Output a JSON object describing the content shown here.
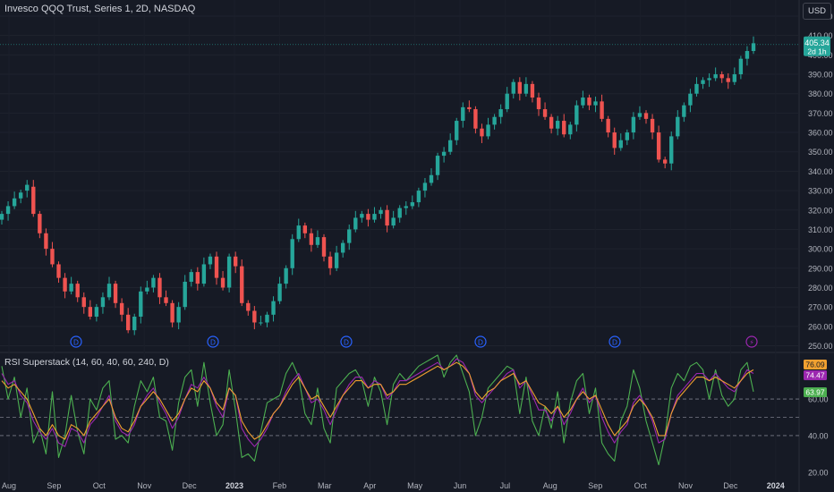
{
  "header": {
    "title": "Invesco QQQ Trust, Series 1, 2D, NASDAQ",
    "currency": "USD"
  },
  "price_badge": {
    "value": "405.34",
    "countdown": "2d 1h"
  },
  "rsi_panel": {
    "title": "RSI Superstack (14, 60, 40, 60, 240, D)",
    "badges": [
      "76.09",
      "74.47",
      "63.97"
    ]
  },
  "colors": {
    "background": "#161a25",
    "up": "#26a69a",
    "down": "#ef5350",
    "rsi_orange": "#f0a030",
    "rsi_purple": "#9c27b0",
    "rsi_green": "#4caf50",
    "dividend_marker": "#2962ff",
    "split_marker": "#9c27b0"
  },
  "event_markers": [
    {
      "label": "D",
      "type": "dividend"
    },
    {
      "label": "D",
      "type": "dividend"
    },
    {
      "label": "D",
      "type": "dividend"
    },
    {
      "label": "D",
      "type": "dividend"
    },
    {
      "label": "D",
      "type": "dividend"
    },
    {
      "label": "⚡",
      "type": "split"
    }
  ],
  "chart_data": [
    {
      "type": "candlestick",
      "title": "Invesco QQQ Trust, Series 1, 2D, NASDAQ",
      "ylim": [
        247,
        420
      ],
      "yticks": [
        250,
        260,
        270,
        280,
        290,
        300,
        310,
        320,
        330,
        340,
        350,
        360,
        370,
        380,
        390,
        400,
        410,
        420
      ],
      "ytick_labels": [
        "250.00",
        "260.00",
        "270.00",
        "280.00",
        "290.00",
        "300.00",
        "310.00",
        "320.00",
        "330.00",
        "340.00",
        "350.00",
        "360.00",
        "370.00",
        "380.00",
        "390.00",
        "400.00",
        "410.00",
        "420.00"
      ],
      "last_price": 405.34,
      "xlabels": [
        "Aug",
        "Sep",
        "Oct",
        "Nov",
        "Dec",
        "2023",
        "Feb",
        "Mar",
        "Apr",
        "May",
        "Jun",
        "Jul",
        "Aug",
        "Sep",
        "Oct",
        "Nov",
        "Dec",
        "2024"
      ],
      "close": [
        318,
        322,
        326,
        329,
        333,
        318,
        308,
        300,
        292,
        285,
        278,
        282,
        275,
        270,
        265,
        270,
        275,
        282,
        272,
        266,
        258,
        265,
        278,
        280,
        285,
        275,
        272,
        262,
        270,
        283,
        288,
        282,
        292,
        296,
        285,
        280,
        296,
        291,
        272,
        268,
        262,
        262,
        266,
        273,
        282,
        290,
        305,
        312,
        308,
        302,
        306,
        296,
        290,
        298,
        303,
        310,
        316,
        318,
        315,
        318,
        320,
        312,
        316,
        321,
        322,
        324,
        330,
        334,
        338,
        348,
        350,
        356,
        366,
        373,
        372,
        362,
        358,
        364,
        368,
        372,
        380,
        386,
        380,
        385,
        378,
        372,
        368,
        362,
        366,
        359,
        364,
        374,
        378,
        374,
        376,
        367,
        360,
        352,
        356,
        360,
        368,
        370,
        367,
        360,
        346,
        344,
        358,
        368,
        374,
        380,
        385,
        387,
        388,
        390,
        388,
        386,
        390,
        398,
        402,
        406
      ],
      "open": [
        315,
        318,
        322,
        326,
        330,
        332,
        318,
        308,
        300,
        292,
        285,
        278,
        282,
        275,
        270,
        265,
        270,
        275,
        282,
        272,
        266,
        258,
        265,
        278,
        280,
        285,
        275,
        272,
        262,
        270,
        283,
        288,
        282,
        292,
        296,
        285,
        280,
        296,
        291,
        272,
        268,
        262,
        262,
        266,
        273,
        282,
        290,
        305,
        312,
        308,
        302,
        306,
        296,
        290,
        298,
        303,
        310,
        316,
        318,
        315,
        318,
        320,
        312,
        316,
        321,
        322,
        324,
        330,
        334,
        338,
        348,
        350,
        356,
        366,
        373,
        372,
        362,
        358,
        364,
        368,
        372,
        380,
        386,
        380,
        385,
        378,
        372,
        368,
        362,
        366,
        359,
        364,
        374,
        378,
        374,
        376,
        367,
        360,
        352,
        356,
        360,
        368,
        370,
        367,
        360,
        346,
        344,
        358,
        368,
        374,
        380,
        385,
        387,
        388,
        390,
        388,
        386,
        390,
        398,
        402
      ]
    },
    {
      "type": "line",
      "title": "RSI Superstack (14, 60, 40, 60, 240, D)",
      "ylim": [
        15,
        85
      ],
      "yticks": [
        20,
        40,
        60
      ],
      "ytick_labels": [
        "20.00",
        "40.00",
        "60.00"
      ],
      "hlines": [
        40,
        50,
        60
      ],
      "series": [
        {
          "name": "",
          "color": "#f0a030",
          "last": 76.09,
          "values": [
            70,
            66,
            68,
            64,
            60,
            52,
            44,
            40,
            46,
            40,
            38,
            46,
            44,
            40,
            48,
            52,
            56,
            60,
            50,
            44,
            42,
            48,
            56,
            60,
            64,
            60,
            54,
            48,
            52,
            60,
            66,
            64,
            70,
            66,
            58,
            54,
            66,
            62,
            48,
            42,
            38,
            40,
            46,
            52,
            56,
            62,
            68,
            72,
            66,
            60,
            62,
            56,
            50,
            56,
            62,
            66,
            70,
            70,
            66,
            68,
            68,
            62,
            64,
            68,
            68,
            70,
            72,
            74,
            76,
            78,
            76,
            78,
            80,
            78,
            74,
            64,
            60,
            64,
            66,
            70,
            72,
            74,
            68,
            70,
            64,
            58,
            56,
            52,
            56,
            50,
            54,
            60,
            64,
            60,
            62,
            54,
            46,
            40,
            44,
            48,
            56,
            60,
            56,
            50,
            40,
            40,
            52,
            60,
            64,
            68,
            72,
            72,
            70,
            72,
            70,
            68,
            66,
            70,
            74,
            76
          ]
        },
        {
          "name": "",
          "color": "#9c27b0",
          "last": 74.47,
          "values": [
            74,
            68,
            70,
            62,
            58,
            48,
            42,
            38,
            44,
            36,
            34,
            44,
            42,
            36,
            46,
            50,
            56,
            62,
            48,
            42,
            40,
            46,
            56,
            62,
            66,
            58,
            52,
            44,
            50,
            60,
            68,
            66,
            72,
            66,
            56,
            50,
            66,
            62,
            44,
            38,
            34,
            38,
            44,
            52,
            56,
            64,
            70,
            74,
            66,
            58,
            60,
            54,
            46,
            54,
            62,
            68,
            72,
            72,
            66,
            70,
            68,
            60,
            64,
            70,
            70,
            72,
            74,
            76,
            78,
            80,
            76,
            78,
            82,
            80,
            74,
            62,
            58,
            62,
            66,
            70,
            74,
            76,
            66,
            70,
            62,
            54,
            54,
            48,
            56,
            46,
            52,
            60,
            66,
            58,
            62,
            50,
            42,
            36,
            42,
            46,
            58,
            62,
            56,
            48,
            36,
            38,
            52,
            62,
            66,
            70,
            74,
            74,
            70,
            74,
            70,
            66,
            64,
            70,
            76,
            74
          ]
        },
        {
          "name": "",
          "color": "#4caf50",
          "last": 63.97,
          "values": [
            78,
            60,
            72,
            50,
            66,
            36,
            44,
            30,
            64,
            28,
            40,
            62,
            42,
            30,
            60,
            54,
            66,
            70,
            38,
            40,
            36,
            56,
            70,
            64,
            72,
            50,
            48,
            32,
            58,
            72,
            76,
            56,
            80,
            58,
            40,
            46,
            76,
            54,
            28,
            30,
            26,
            42,
            58,
            60,
            62,
            74,
            80,
            72,
            52,
            46,
            66,
            44,
            36,
            66,
            70,
            74,
            76,
            70,
            56,
            72,
            64,
            46,
            68,
            74,
            70,
            74,
            78,
            80,
            82,
            84,
            72,
            80,
            84,
            74,
            64,
            40,
            50,
            66,
            70,
            74,
            78,
            76,
            52,
            72,
            48,
            40,
            56,
            44,
            64,
            36,
            58,
            70,
            74,
            52,
            66,
            36,
            30,
            26,
            48,
            56,
            76,
            66,
            48,
            36,
            24,
            40,
            66,
            74,
            70,
            78,
            80,
            76,
            60,
            76,
            62,
            56,
            60,
            76,
            80,
            64
          ]
        }
      ]
    }
  ]
}
